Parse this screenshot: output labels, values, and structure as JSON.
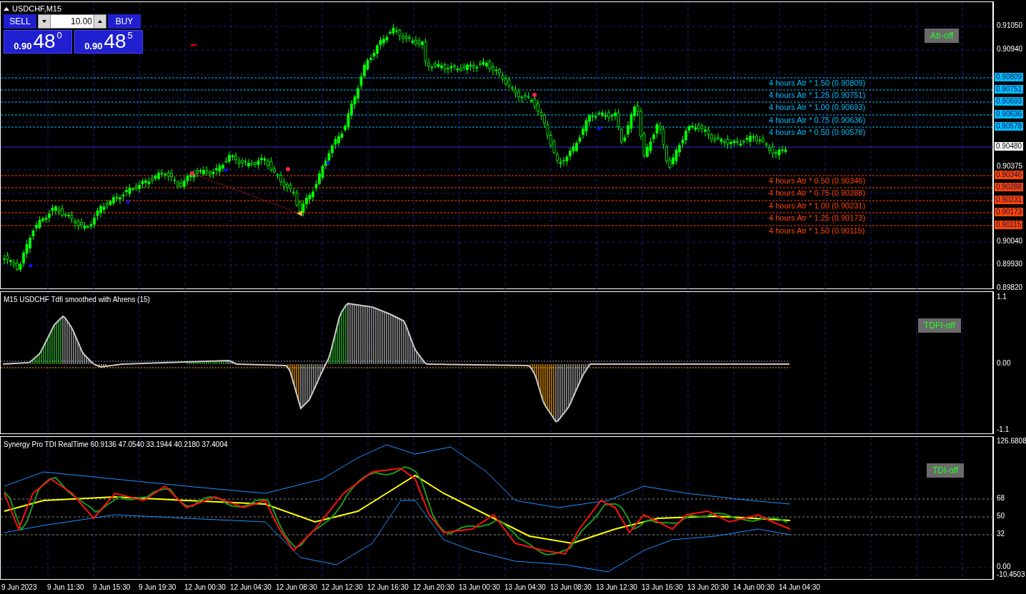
{
  "chart": {
    "title": "USDCHF,M15"
  },
  "trade_panel": {
    "sell_label": "SELL",
    "buy_label": "BUY",
    "volume": "10.00",
    "sell_price": {
      "prefix": "0.90",
      "big": "48",
      "sup": "0"
    },
    "buy_price": {
      "prefix": "0.90",
      "big": "48",
      "sup": "5"
    }
  },
  "price_panel": {
    "toggle": "Atr-off",
    "axis_ticks": [
      "0.91050",
      "0.90940",
      "0.90375",
      "0.90040",
      "0.89930",
      "0.89820"
    ],
    "current_price": "0.90480",
    "atr_levels": [
      {
        "label": "4 hours Atr * 1.50 (0.90809)",
        "tag": "0.90809",
        "color": "#00bfff"
      },
      {
        "label": "4 hours Atr * 1.25 (0.90751)",
        "tag": "0.90751",
        "color": "#00bfff"
      },
      {
        "label": "4 hours Atr * 1.00 (0.90693)",
        "tag": "0.90693",
        "color": "#00bfff"
      },
      {
        "label": "4 hours Atr * 0.75 (0.90636)",
        "tag": "0.90636",
        "color": "#00bfff"
      },
      {
        "label": "4 hours Atr * 0.50 (0.90578)",
        "tag": "0.90578",
        "color": "#00bfff"
      },
      {
        "label": "4 hours Atr * 0.50 (0.90346)",
        "tag": "0.90346",
        "color": "#ff4500"
      },
      {
        "label": "4 hours Atr * 0.75 (0.90288)",
        "tag": "0.90288",
        "color": "#ff4500"
      },
      {
        "label": "4 hours Atr * 1.00 (0.90231)",
        "tag": "0.90231",
        "color": "#ff4500"
      },
      {
        "label": "4 hours Atr * 1.25 (0.90173)",
        "tag": "0.90173",
        "color": "#ff4500"
      },
      {
        "label": "4 hours Atr * 1.50 (0.90115)",
        "tag": "0.90115",
        "color": "#ff4500"
      }
    ]
  },
  "tdfi_panel": {
    "title": "M15 USDCHF Tdfi smoothed with Ahrens (15)",
    "toggle": "TDFI-off",
    "axis_ticks": [
      "1.1",
      "0.00",
      "-1.1"
    ]
  },
  "tdi_panel": {
    "title": "Synergy Pro TDI RealTime 60.9136 47.0540 33.1944 40.2180 37.4004",
    "toggle": "TDI-off",
    "axis_ticks": [
      "126.6808",
      "68",
      "50",
      "32",
      "0.00",
      "-10.4503"
    ]
  },
  "time_axis": [
    "9 Jun 2023",
    "9 Jun 11:30",
    "9 Jun 15:30",
    "9 Jun 19:30",
    "12 Jun 00:30",
    "12 Jun 04:30",
    "12 Jun 08:30",
    "12 Jun 12:30",
    "12 Jun 16:30",
    "12 Jun 20:30",
    "13 Jun 00:30",
    "13 Jun 04:30",
    "13 Jun 08:30",
    "13 Jun 12:30",
    "13 Jun 16:30",
    "13 Jun 20:30",
    "14 Jun 00:30",
    "14 Jun 04:30"
  ]
}
